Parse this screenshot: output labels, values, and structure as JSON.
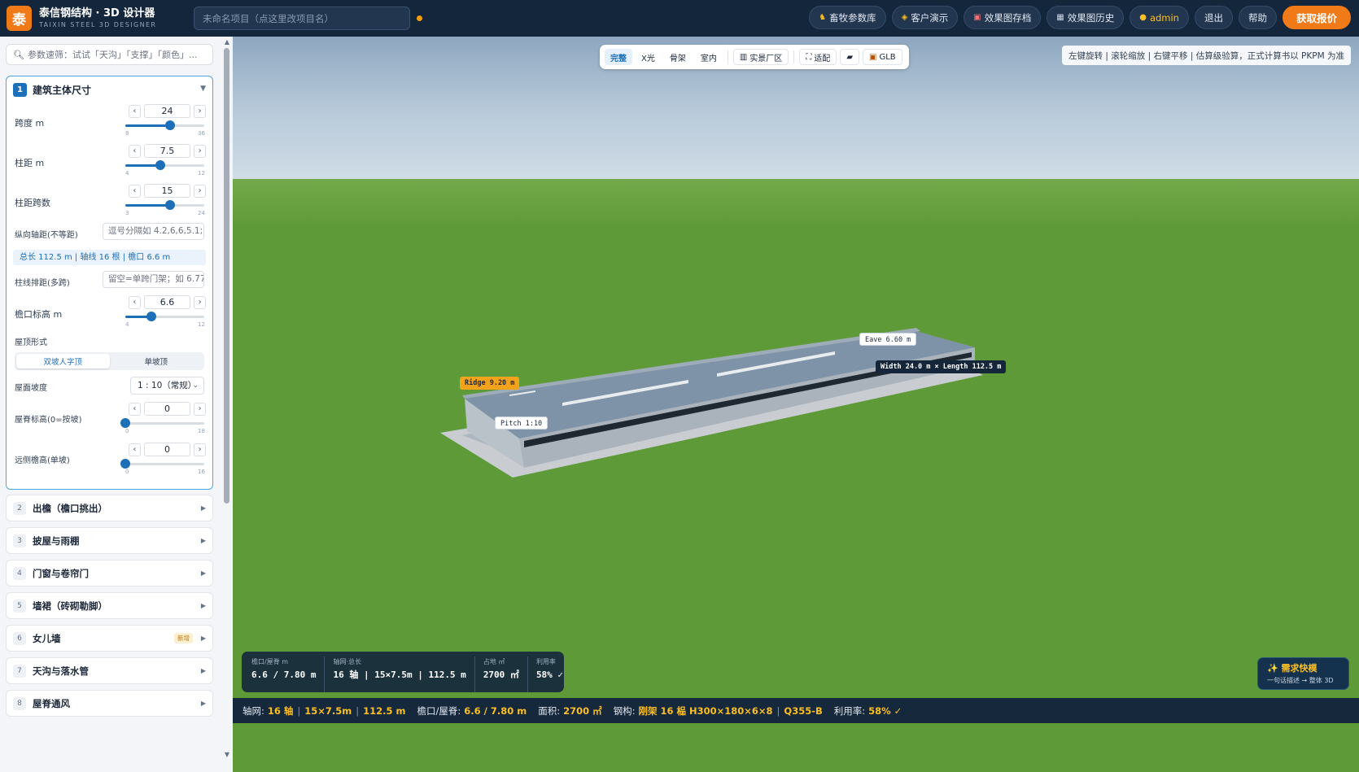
{
  "header": {
    "logo": "泰",
    "title": "泰信钢结构 · 3D 设计器",
    "subtitle": "TAIXIN STEEL 3D DESIGNER",
    "project_placeholder": "未命名项目（点这里改项目名）",
    "nav": [
      {
        "label": "畜牧参数库",
        "icon": "cow-icon"
      },
      {
        "label": "客户演示",
        "icon": "shield-icon"
      },
      {
        "label": "效果图存档",
        "icon": "save-icon"
      },
      {
        "label": "效果图历史",
        "icon": "history-icon"
      }
    ],
    "user": "admin",
    "logout": "退出",
    "help": "帮助",
    "cta": "获取报价"
  },
  "sidebar": {
    "search_placeholder": "参数速筛：试试「天沟」「支撑」「颜色」...",
    "section1": {
      "num": "1",
      "title": "建筑主体尺寸",
      "span": {
        "label": "跨度 m",
        "value": "24",
        "min": "8",
        "max": "36",
        "fraction": 0.57
      },
      "bay": {
        "label": "柱距 m",
        "value": "7.5",
        "min": "4",
        "max": "12",
        "fraction": 0.44
      },
      "bays": {
        "label": "柱距跨数",
        "value": "15",
        "min": "3",
        "max": "24",
        "fraction": 0.57
      },
      "uneven_label": "纵向轴距(不等距)",
      "uneven_placeholder": "逗号分隔如 4.2,6,6,5.1;",
      "info": "总长 112.5 m  |  轴线 16 根  |  檐口 6.6 m",
      "row_label": "柱线排距(多跨)",
      "row_placeholder": "留空=单跨门架；如 6.77",
      "eave": {
        "label": "檐口标高 m",
        "value": "6.6",
        "min": "4",
        "max": "12",
        "fraction": 0.33
      },
      "roof_label": "屋顶形式",
      "roof_options": [
        "双坡人字顶",
        "单坡顶"
      ],
      "slope_label": "屋面坡度",
      "slope_value": "1 : 10（常规）",
      "ridge": {
        "label": "屋脊标高(0=按坡)",
        "value": "0",
        "min": "0",
        "max": "18",
        "fraction": 0
      },
      "far": {
        "label": "远侧檐高(单坡)",
        "value": "0",
        "min": "0",
        "max": "16",
        "fraction": 0
      }
    },
    "sections": [
      {
        "num": "2",
        "title": "出檐（檐口挑出）"
      },
      {
        "num": "3",
        "title": "披屋与雨棚"
      },
      {
        "num": "4",
        "title": "门窗与卷帘门"
      },
      {
        "num": "5",
        "title": "墙裙（砖砌勒脚）"
      },
      {
        "num": "6",
        "title": "女儿墙",
        "badge": "新增"
      },
      {
        "num": "7",
        "title": "天沟与落水管"
      },
      {
        "num": "8",
        "title": "屋脊通风"
      }
    ]
  },
  "viewport": {
    "tabs": [
      "完整",
      "X光",
      "骨架",
      "室内"
    ],
    "scene_btn": "实景厂区",
    "fit_btn": "适配",
    "glb_btn": "GLB",
    "hint": "左键旋转  |  滚轮缩放  |  右键平移  |  估算级验算，正式计算书以 PKPM 为准",
    "labels": {
      "ridge": "Ridge 9.20 m",
      "eave": "Eave 6.60 m",
      "size": "Width 24.0 m × Length 112.5 m",
      "pitch": "Pitch 1:10"
    },
    "stats": [
      {
        "label": "檐口/屋脊 m",
        "value": "6.6 / 7.80 m"
      },
      {
        "label": "轴网·总长",
        "value": "16 轴 | 15×7.5m | 112.5 m"
      },
      {
        "label": "占地 ㎡",
        "value": "2700 ㎡"
      },
      {
        "label": "利用率",
        "value": "58% ✓"
      }
    ],
    "quick_title": "✨ 需求快模",
    "quick_sub": "一句话描述 → 整体 3D"
  },
  "statusbar": {
    "axis_k": "轴网:",
    "axis_v1": "16 轴",
    "axis_v2": "15×7.5m",
    "axis_v3": "112.5 m",
    "eave_k": "檐口/屋脊:",
    "eave_v": "6.6 / 7.80 m",
    "area_k": "面积:",
    "area_v": "2700 ㎡",
    "steel_k": "钢构:",
    "steel_v1": "刚架 16 榀 H300×180×6×8",
    "steel_v2": "Q355-B",
    "util_k": "利用率:",
    "util_v": "58% ✓"
  }
}
